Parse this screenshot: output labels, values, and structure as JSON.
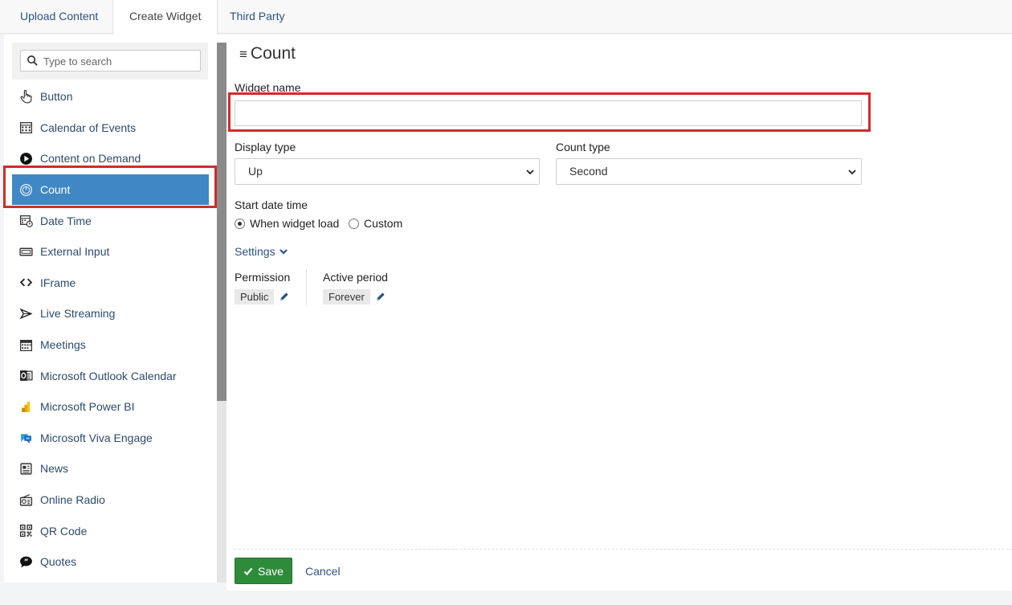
{
  "tabs": [
    {
      "label": "Upload Content"
    },
    {
      "label": "Create Widget"
    },
    {
      "label": "Third Party"
    }
  ],
  "search": {
    "placeholder": "Type to search"
  },
  "widgets": [
    {
      "label": "Button",
      "icon": "hand-pointer-icon"
    },
    {
      "label": "Calendar of Events",
      "icon": "calendar-grid-icon"
    },
    {
      "label": "Content on Demand",
      "icon": "play-circle-icon"
    },
    {
      "label": "Count",
      "icon": "counter-icon"
    },
    {
      "label": "Date Time",
      "icon": "calendar-clock-icon"
    },
    {
      "label": "External Input",
      "icon": "input-box-icon"
    },
    {
      "label": "IFrame",
      "icon": "code-brackets-icon"
    },
    {
      "label": "Live Streaming",
      "icon": "broadcast-icon"
    },
    {
      "label": "Meetings",
      "icon": "calendar-icon"
    },
    {
      "label": "Microsoft Outlook Calendar",
      "icon": "outlook-icon"
    },
    {
      "label": "Microsoft Power BI",
      "icon": "power-bi-icon"
    },
    {
      "label": "Microsoft Viva Engage",
      "icon": "viva-engage-icon"
    },
    {
      "label": "News",
      "icon": "newspaper-icon"
    },
    {
      "label": "Online Radio",
      "icon": "radio-icon"
    },
    {
      "label": "QR Code",
      "icon": "qr-code-icon"
    },
    {
      "label": "Quotes",
      "icon": "quote-bubble-icon"
    }
  ],
  "form": {
    "title": "Count",
    "widget_name_label": "Widget name",
    "widget_name_value": "",
    "display_type_label": "Display type",
    "display_type_value": "Up",
    "count_type_label": "Count type",
    "count_type_value": "Second",
    "start_label": "Start date time",
    "start_option_1": "When widget load",
    "start_option_2": "Custom",
    "settings_label": "Settings",
    "permission_label": "Permission",
    "permission_value": "Public",
    "active_period_label": "Active period",
    "active_period_value": "Forever",
    "save_label": "Save",
    "cancel_label": "Cancel"
  },
  "colors": {
    "active_item": "#3f88c5",
    "highlight": "#d42a2a",
    "save": "#2e8b3a",
    "link": "#2c5282"
  }
}
